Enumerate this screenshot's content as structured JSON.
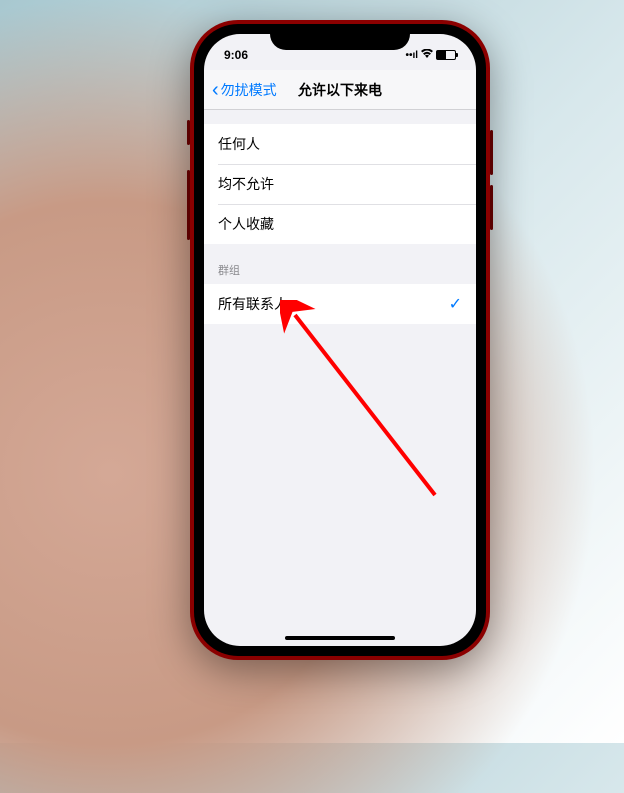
{
  "status": {
    "time": "9:06",
    "signal_icon": "signal",
    "wifi_icon": "wifi",
    "battery_icon": "battery"
  },
  "nav": {
    "back_label": "勿扰模式",
    "title": "允许以下来电"
  },
  "sections": {
    "main": {
      "items": [
        {
          "label": "任何人",
          "selected": false
        },
        {
          "label": "均不允许",
          "selected": false
        },
        {
          "label": "个人收藏",
          "selected": false
        }
      ]
    },
    "groups": {
      "header": "群组",
      "items": [
        {
          "label": "所有联系人",
          "selected": true
        }
      ]
    }
  },
  "checkmark_glyph": "✓"
}
